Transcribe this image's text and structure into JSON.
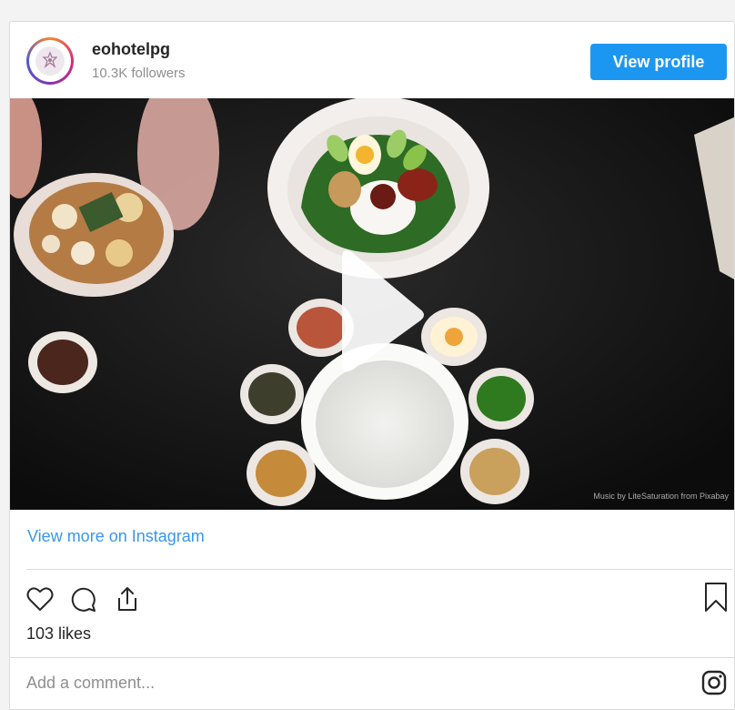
{
  "header": {
    "username": "eohotelpg",
    "followers": "10.3K followers",
    "view_profile_label": "View profile"
  },
  "video": {
    "music_credit": "Music by LiteSaturation from Pixabay",
    "play_icon": "play-icon"
  },
  "links": {
    "view_more": "View more on Instagram"
  },
  "actions": {
    "icons": [
      "heart-icon",
      "comment-icon",
      "share-icon",
      "bookmark-icon"
    ]
  },
  "likes": "103 likes",
  "comment": {
    "placeholder": "Add a comment...",
    "icon": "instagram-icon"
  },
  "colors": {
    "accent": "#1c97f1",
    "link": "#3897f0",
    "text": "#262626",
    "muted": "#8e8e8e",
    "border": "#dbdbdb"
  }
}
